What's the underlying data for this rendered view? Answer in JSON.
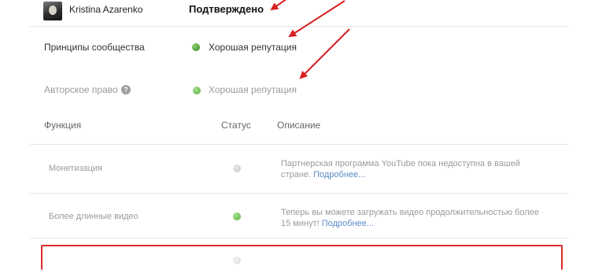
{
  "account": {
    "username": "Kristina Azarenko",
    "verification_status": "Подтверждено"
  },
  "standing": [
    {
      "label": "Принципы сообщества",
      "status": "Хорошая репутация"
    },
    {
      "label": "Авторское право",
      "help_icon": "?",
      "status": "Хорошая репутация"
    }
  ],
  "table": {
    "headers": {
      "feature": "Функция",
      "status": "Статус",
      "description": "Описание"
    },
    "rows": [
      {
        "feature": "Монетизация",
        "status_color": "gray",
        "description_line1": "Партнерская программа YouTube пока недоступна в вашей",
        "description_line2": "стране.",
        "more_link": "Подробнее..."
      },
      {
        "feature": "Более длинные видео",
        "status_color": "green",
        "description_line1": "Теперь вы можете загружать видео продолжительностью более",
        "description_line2": "15 минут!",
        "more_link": "Подробнее..."
      }
    ]
  },
  "colors": {
    "highlight_red": "#dd2a2a",
    "link_blue": "#5a8bc8",
    "status_green": "#4e9a37"
  },
  "icons": {
    "help": "help-icon",
    "status_dot": "status-dot-icon",
    "annotation": "red-arrow-icon"
  }
}
